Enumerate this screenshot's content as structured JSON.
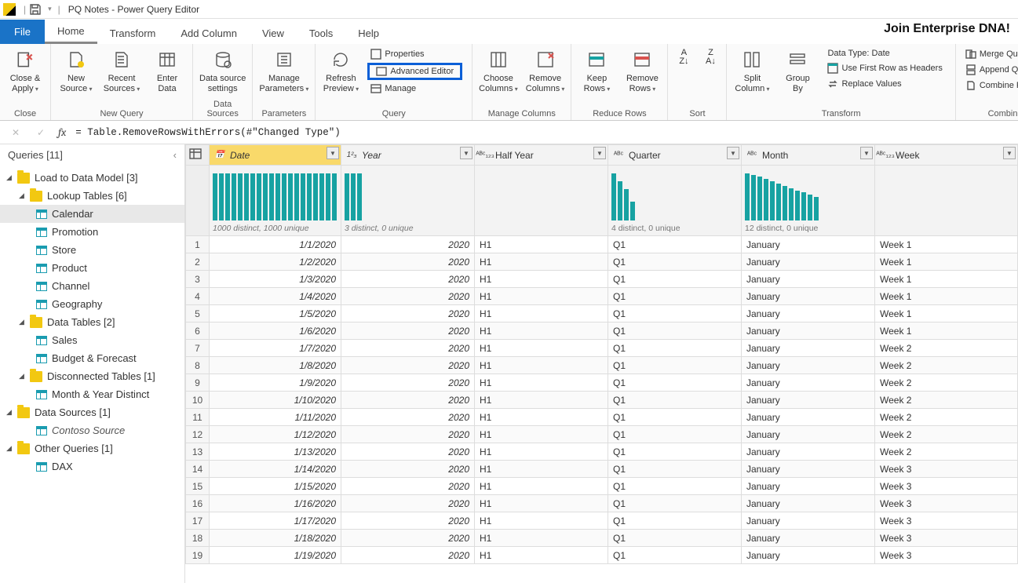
{
  "titlebar": {
    "title": "PQ Notes - Power Query Editor"
  },
  "banner": "Join Enterprise DNA!",
  "menu": {
    "file": "File",
    "home": "Home",
    "transform": "Transform",
    "add_column": "Add Column",
    "view": "View",
    "tools": "Tools",
    "help": "Help"
  },
  "ribbon": {
    "close": {
      "label": "Close &\nApply",
      "group": "Close"
    },
    "newquery": {
      "new_source": "New\nSource",
      "recent": "Recent\nSources",
      "enter": "Enter\nData",
      "group": "New Query"
    },
    "datasources": {
      "settings": "Data source\nsettings",
      "group": "Data Sources"
    },
    "parameters": {
      "manage": "Manage\nParameters",
      "group": "Parameters"
    },
    "query": {
      "refresh": "Refresh\nPreview",
      "properties": "Properties",
      "advanced": "Advanced Editor",
      "manage": "Manage",
      "group": "Query"
    },
    "managecols": {
      "choose": "Choose\nColumns",
      "remove": "Remove\nColumns",
      "group": "Manage Columns"
    },
    "reducerows": {
      "keep": "Keep\nRows",
      "remove": "Remove\nRows",
      "group": "Reduce Rows"
    },
    "sort": {
      "group": "Sort"
    },
    "splitgroup": {
      "split": "Split\nColumn",
      "groupby": "Group\nBy"
    },
    "transform": {
      "datatype": "Data Type: Date",
      "firstrow": "Use First Row as Headers",
      "replace": "Replace Values",
      "group": "Transform"
    },
    "combine": {
      "merge": "Merge Queries",
      "append": "Append Queries",
      "files": "Combine Files",
      "group": "Combine"
    }
  },
  "formula": {
    "text": "= Table.RemoveRowsWithErrors(#\"Changed Type\")"
  },
  "sidebar": {
    "title": "Queries [11]",
    "items": [
      {
        "depth": 0,
        "type": "folder",
        "label": "Load to Data Model [3]"
      },
      {
        "depth": 1,
        "type": "folder",
        "label": "Lookup Tables [6]"
      },
      {
        "depth": 2,
        "type": "table",
        "label": "Calendar",
        "selected": true
      },
      {
        "depth": 2,
        "type": "table",
        "label": "Promotion"
      },
      {
        "depth": 2,
        "type": "table",
        "label": "Store"
      },
      {
        "depth": 2,
        "type": "table",
        "label": "Product"
      },
      {
        "depth": 2,
        "type": "table",
        "label": "Channel"
      },
      {
        "depth": 2,
        "type": "table",
        "label": "Geography"
      },
      {
        "depth": 1,
        "type": "folder",
        "label": "Data Tables [2]"
      },
      {
        "depth": 2,
        "type": "table",
        "label": "Sales"
      },
      {
        "depth": 2,
        "type": "table",
        "label": "Budget & Forecast"
      },
      {
        "depth": 1,
        "type": "folder",
        "label": "Disconnected Tables [1]"
      },
      {
        "depth": 2,
        "type": "table",
        "label": "Month & Year Distinct"
      },
      {
        "depth": 0,
        "type": "folder",
        "label": "Data Sources [1]"
      },
      {
        "depth": 2,
        "type": "table",
        "label": "Contoso Source",
        "italic": true
      },
      {
        "depth": 0,
        "type": "folder",
        "label": "Other Queries [1]"
      },
      {
        "depth": 2,
        "type": "table",
        "label": "DAX"
      }
    ]
  },
  "grid": {
    "columns": [
      {
        "name": "Date",
        "type": "date",
        "stats": "1000 distinct, 1000 unique",
        "selected": true,
        "bars": [
          60,
          60,
          60,
          60,
          60,
          60,
          60,
          60,
          60,
          60,
          60,
          60,
          60,
          60,
          60,
          60,
          60,
          60,
          60,
          60
        ]
      },
      {
        "name": "Year",
        "type": "123",
        "stats": "3 distinct, 0 unique",
        "bars": [
          60,
          60,
          60
        ]
      },
      {
        "name": "Half Year",
        "type": "ABC123",
        "stats": "",
        "bars": []
      },
      {
        "name": "Quarter",
        "type": "ABC",
        "stats": "4 distinct, 0 unique",
        "bars": [
          60,
          50,
          40,
          24
        ]
      },
      {
        "name": "Month",
        "type": "ABC",
        "stats": "12 distinct, 0 unique",
        "bars": [
          60,
          58,
          56,
          53,
          50,
          47,
          44,
          41,
          38,
          36,
          33,
          30
        ]
      },
      {
        "name": "Week",
        "type": "ABC123",
        "stats": "",
        "bars": []
      }
    ],
    "rows": [
      {
        "n": 1,
        "date": "1/1/2020",
        "year": "2020",
        "half": "H1",
        "q": "Q1",
        "month": "January",
        "week": "Week 1"
      },
      {
        "n": 2,
        "date": "1/2/2020",
        "year": "2020",
        "half": "H1",
        "q": "Q1",
        "month": "January",
        "week": "Week 1"
      },
      {
        "n": 3,
        "date": "1/3/2020",
        "year": "2020",
        "half": "H1",
        "q": "Q1",
        "month": "January",
        "week": "Week 1"
      },
      {
        "n": 4,
        "date": "1/4/2020",
        "year": "2020",
        "half": "H1",
        "q": "Q1",
        "month": "January",
        "week": "Week 1"
      },
      {
        "n": 5,
        "date": "1/5/2020",
        "year": "2020",
        "half": "H1",
        "q": "Q1",
        "month": "January",
        "week": "Week 1"
      },
      {
        "n": 6,
        "date": "1/6/2020",
        "year": "2020",
        "half": "H1",
        "q": "Q1",
        "month": "January",
        "week": "Week 1"
      },
      {
        "n": 7,
        "date": "1/7/2020",
        "year": "2020",
        "half": "H1",
        "q": "Q1",
        "month": "January",
        "week": "Week 2"
      },
      {
        "n": 8,
        "date": "1/8/2020",
        "year": "2020",
        "half": "H1",
        "q": "Q1",
        "month": "January",
        "week": "Week 2"
      },
      {
        "n": 9,
        "date": "1/9/2020",
        "year": "2020",
        "half": "H1",
        "q": "Q1",
        "month": "January",
        "week": "Week 2"
      },
      {
        "n": 10,
        "date": "1/10/2020",
        "year": "2020",
        "half": "H1",
        "q": "Q1",
        "month": "January",
        "week": "Week 2"
      },
      {
        "n": 11,
        "date": "1/11/2020",
        "year": "2020",
        "half": "H1",
        "q": "Q1",
        "month": "January",
        "week": "Week 2"
      },
      {
        "n": 12,
        "date": "1/12/2020",
        "year": "2020",
        "half": "H1",
        "q": "Q1",
        "month": "January",
        "week": "Week 2"
      },
      {
        "n": 13,
        "date": "1/13/2020",
        "year": "2020",
        "half": "H1",
        "q": "Q1",
        "month": "January",
        "week": "Week 2"
      },
      {
        "n": 14,
        "date": "1/14/2020",
        "year": "2020",
        "half": "H1",
        "q": "Q1",
        "month": "January",
        "week": "Week 3"
      },
      {
        "n": 15,
        "date": "1/15/2020",
        "year": "2020",
        "half": "H1",
        "q": "Q1",
        "month": "January",
        "week": "Week 3"
      },
      {
        "n": 16,
        "date": "1/16/2020",
        "year": "2020",
        "half": "H1",
        "q": "Q1",
        "month": "January",
        "week": "Week 3"
      },
      {
        "n": 17,
        "date": "1/17/2020",
        "year": "2020",
        "half": "H1",
        "q": "Q1",
        "month": "January",
        "week": "Week 3"
      },
      {
        "n": 18,
        "date": "1/18/2020",
        "year": "2020",
        "half": "H1",
        "q": "Q1",
        "month": "January",
        "week": "Week 3"
      },
      {
        "n": 19,
        "date": "1/19/2020",
        "year": "2020",
        "half": "H1",
        "q": "Q1",
        "month": "January",
        "week": "Week 3"
      }
    ]
  }
}
